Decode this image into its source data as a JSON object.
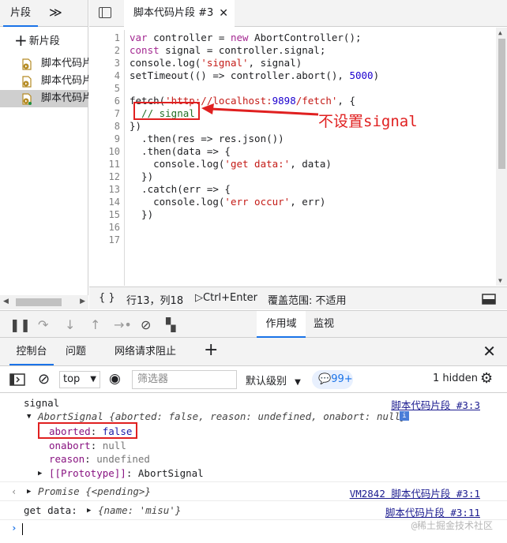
{
  "left_pane": {
    "tab_label": "片段",
    "more_glyph": "≫",
    "new_snippet_label": "新片段",
    "snippets": [
      "脚本代码片",
      "脚本代码片",
      "脚本代码片"
    ]
  },
  "editor": {
    "tab_label": "脚本代码片段 #3",
    "close_glyph": "✕",
    "line_numbers": [
      "1",
      "2",
      "3",
      "4",
      "5",
      "6",
      "7",
      "8",
      "9",
      "10",
      "11",
      "12",
      "13",
      "14",
      "15",
      "16",
      "17"
    ],
    "lines": [
      "var controller = new AbortController();",
      "const signal = controller.signal;",
      "console.log('signal', signal)",
      "setTimeout(() => controller.abort(), 5000)",
      "",
      "fetch('http://localhost:9898/fetch', {",
      "  // signal",
      "})",
      "  .then(res => res.json())",
      "  .then(data => {",
      "    console.log('get data:', data)",
      "  })",
      "  .catch(err => {",
      "    console.log('err occur', err)",
      "  })",
      "",
      ""
    ],
    "annotation": "不设置signal"
  },
  "status_bar": {
    "braces": "{ }",
    "position": "行13，列18",
    "run_shortcut": "Ctrl+Enter",
    "coverage": "覆盖范围: 不适用"
  },
  "debugger": {
    "scope_tab": "作用域",
    "watch_tab": "监视"
  },
  "drawer": {
    "tabs": [
      "控制台",
      "问题",
      "网络请求阻止"
    ],
    "plus": "+",
    "close": "✕"
  },
  "console_toolbar": {
    "context": "top",
    "filter_placeholder": "筛选器",
    "levels": "默认级别",
    "issues_badge": "99+",
    "hidden": "1 hidden"
  },
  "console": {
    "rows": [
      {
        "text": "signal",
        "source": "脚本代码片段 #3:3"
      },
      {
        "text": "AbortSignal {aborted: false, reason: undefined, onabort: null}"
      },
      {
        "key": "aborted",
        "value": "false"
      },
      {
        "key": "onabort",
        "value": "null"
      },
      {
        "key": "reason",
        "value": "undefined"
      },
      {
        "key": "[[Prototype]]",
        "value": "AbortSignal"
      },
      {
        "text": "Promise {<pending>}",
        "source": "VM2842 脚本代码片段 #3:1"
      },
      {
        "label": "get data:",
        "text": "{name: 'misu'}",
        "source": "脚本代码片段 #3:11"
      }
    ],
    "prompt": "›"
  },
  "watermark": "@稀土掘金技术社区",
  "colors": {
    "accent": "#1a73e8",
    "annotation_red": "#e02020",
    "panel_bg": "#f3f3f3"
  }
}
